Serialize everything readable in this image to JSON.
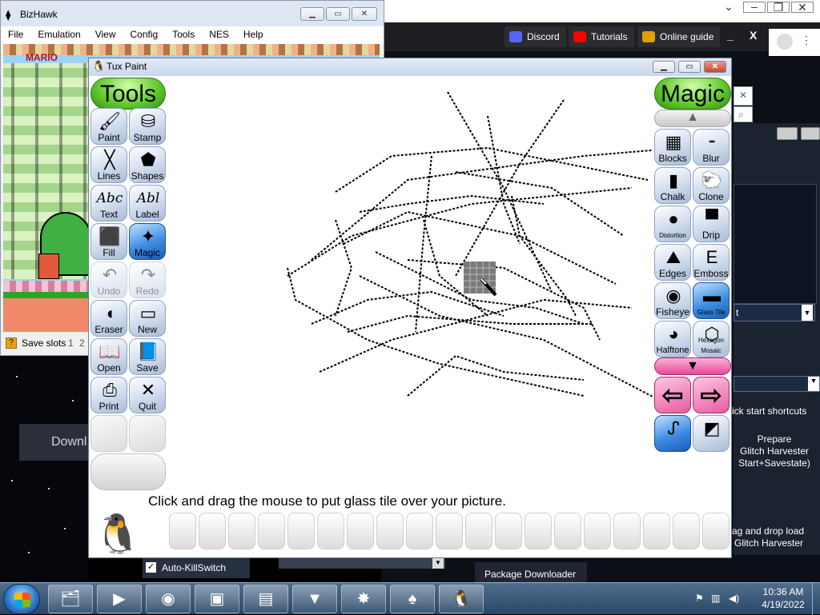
{
  "background_app": {
    "navbar": {
      "buttons": [
        {
          "label": "Discord",
          "icon": "discord-icon",
          "color": "#5865f2"
        },
        {
          "label": "Tutorials",
          "icon": "youtube-icon",
          "color": "#ff0000"
        },
        {
          "label": "Online guide",
          "icon": "guide-icon",
          "color": "#e0a000"
        }
      ],
      "minimize": "_",
      "close": "X"
    },
    "select_text": "t",
    "shortcuts_label": "ick start shortcuts",
    "prepare_text_1": "Prepare",
    "prepare_text_2": "Glitch Harvester",
    "prepare_text_3": "Start+Savestate)",
    "drag_text_1": "ag and drop load",
    "drag_text_2": "Glitch Harvester",
    "package_downloader": "Package Downloader",
    "auto_killswitch": "Auto-KillSwitch",
    "download_partial": "Downl"
  },
  "bizhawk": {
    "title": "BizHawk",
    "menu": [
      "File",
      "Emulation",
      "View",
      "Config",
      "Tools",
      "NES",
      "Help"
    ],
    "status": {
      "label": "Save slots",
      "slots": [
        "1",
        "2"
      ]
    },
    "game_text": "MARIO"
  },
  "tuxpaint": {
    "title": "Tux Paint",
    "tools_header": "Tools",
    "magic_header": "Magic",
    "tools": [
      {
        "label": "Paint",
        "glyph": "🖌",
        "state": "normal"
      },
      {
        "label": "Stamp",
        "glyph": "⛁",
        "state": "normal"
      },
      {
        "label": "Lines",
        "glyph": "╳",
        "state": "normal"
      },
      {
        "label": "Shapes",
        "glyph": "⬟",
        "state": "normal"
      },
      {
        "label": "Text",
        "glyph": "Abc",
        "state": "normal"
      },
      {
        "label": "Label",
        "glyph": "Abl",
        "state": "normal"
      },
      {
        "label": "Fill",
        "glyph": "⬛",
        "state": "normal"
      },
      {
        "label": "Magic",
        "glyph": "✦",
        "state": "selected"
      },
      {
        "label": "Undo",
        "glyph": "↶",
        "state": "disabled"
      },
      {
        "label": "Redo",
        "glyph": "↷",
        "state": "disabled"
      },
      {
        "label": "Eraser",
        "glyph": "◖",
        "state": "normal"
      },
      {
        "label": "New",
        "glyph": "▭",
        "state": "normal"
      },
      {
        "label": "Open",
        "glyph": "📖",
        "state": "normal"
      },
      {
        "label": "Save",
        "glyph": "📘",
        "state": "normal"
      },
      {
        "label": "Print",
        "glyph": "⎙",
        "state": "normal"
      },
      {
        "label": "Quit",
        "glyph": "✕",
        "state": "normal"
      }
    ],
    "magic": [
      {
        "label": "Blocks",
        "glyph": "▦",
        "state": "normal"
      },
      {
        "label": "Blur",
        "glyph": "⁃",
        "state": "normal"
      },
      {
        "label": "Chalk",
        "glyph": "▮",
        "state": "normal"
      },
      {
        "label": "Clone",
        "glyph": "🐑",
        "state": "normal"
      },
      {
        "label": "Distortion",
        "glyph": "●",
        "state": "normal"
      },
      {
        "label": "Drip",
        "glyph": "▀",
        "state": "normal"
      },
      {
        "label": "Edges",
        "glyph": "⛰",
        "state": "normal"
      },
      {
        "label": "Emboss",
        "glyph": "E",
        "state": "normal"
      },
      {
        "label": "Fisheye",
        "glyph": "◉",
        "state": "normal"
      },
      {
        "label": "Glass Tile",
        "glyph": "▬",
        "state": "selected"
      },
      {
        "label": "Halftone",
        "glyph": "◕",
        "state": "normal"
      },
      {
        "label": "Hexagon Mosaic",
        "glyph": "⬡",
        "state": "normal"
      }
    ],
    "nav": {
      "prev": "⇦",
      "next": "⇨"
    },
    "message": "Click and drag the mouse to put glass tile over your picture."
  },
  "taskbar": {
    "apps": [
      {
        "name": "explorer-icon",
        "glyph": "🗂"
      },
      {
        "name": "media-player-icon",
        "glyph": "▶"
      },
      {
        "name": "chrome-icon",
        "glyph": "◉"
      },
      {
        "name": "app-icon",
        "glyph": "▣"
      },
      {
        "name": "control-panel-icon",
        "glyph": "▤"
      },
      {
        "name": "vanguard-icon",
        "glyph": "▼"
      },
      {
        "name": "glitch-icon",
        "glyph": "✸"
      },
      {
        "name": "spy-icon",
        "glyph": "♠"
      },
      {
        "name": "tuxpaint-icon",
        "glyph": "🐧"
      }
    ],
    "time": "10:36 AM",
    "date": "4/19/2022"
  }
}
